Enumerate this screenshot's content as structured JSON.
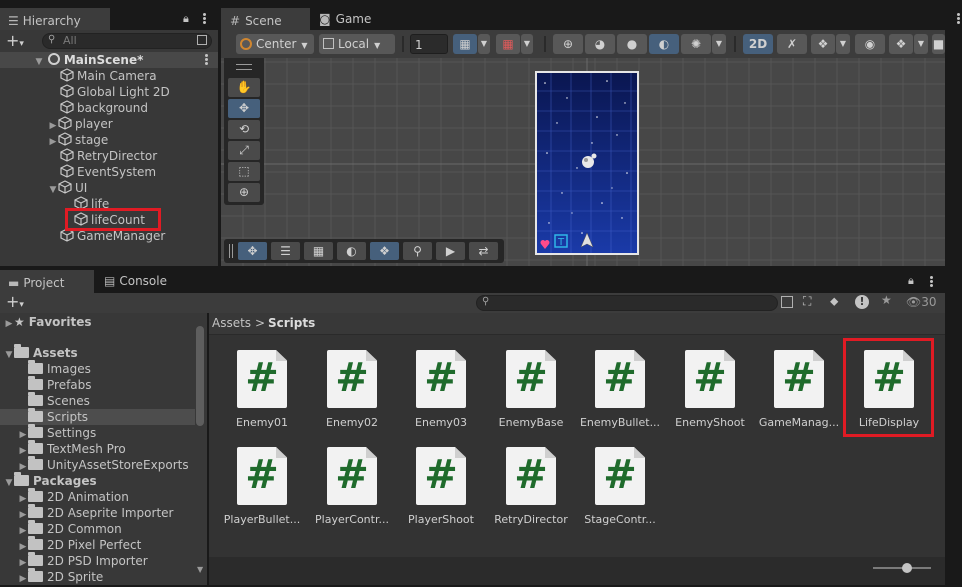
{
  "colors": {
    "accent_blue": "#46607c",
    "highlight_red": "#e01b24",
    "script_green": "#1f6b2c",
    "game_bg": "#0e1d6e",
    "selected_row": "#4d4d4d"
  },
  "hierarchy": {
    "tab_label": "Hierarchy",
    "search_placeholder": "All",
    "scene_name": "MainScene*",
    "items": [
      {
        "label": "Main Camera",
        "expandable": false
      },
      {
        "label": "Global Light 2D",
        "expandable": false
      },
      {
        "label": "background",
        "expandable": false
      },
      {
        "label": "player",
        "expandable": true
      },
      {
        "label": "stage",
        "expandable": true
      },
      {
        "label": "RetryDirector",
        "expandable": false
      },
      {
        "label": "EventSystem",
        "expandable": false
      },
      {
        "label": "UI",
        "expandable": true,
        "expanded": true
      },
      {
        "label": "life",
        "expandable": false
      },
      {
        "label": "lifeCount",
        "expandable": false,
        "highlighted": true
      },
      {
        "label": "GameManager",
        "expandable": false
      }
    ]
  },
  "scene": {
    "tabs": [
      {
        "label": "Scene",
        "icon": "grid-icon"
      },
      {
        "label": "Game",
        "icon": "gamepad-icon"
      }
    ],
    "pivot_label": "Center",
    "space_label": "Local",
    "grid_value": "1",
    "mode_2d_label": "2D"
  },
  "project": {
    "tabs": [
      {
        "label": "Project",
        "icon": "folder-icon"
      },
      {
        "label": "Console",
        "icon": "console-icon"
      }
    ],
    "hidden_count": "30",
    "breadcrumb": {
      "root": "Assets",
      "separator": ">",
      "current": "Scripts"
    },
    "tree": {
      "favorites": "Favorites",
      "assets": "Assets",
      "asset_folders": [
        "Images",
        "Prefabs",
        "Scenes",
        "Scripts",
        "Settings",
        "TextMesh Pro",
        "UnityAssetStoreExports"
      ],
      "packages": "Packages",
      "package_folders": [
        "2D Animation",
        "2D Aseprite Importer",
        "2D Common",
        "2D Pixel Perfect",
        "2D PSD Importer",
        "2D Sprite"
      ]
    },
    "files": [
      "Enemy01",
      "Enemy02",
      "Enemy03",
      "EnemyBase",
      "EnemyBullet...",
      "EnemyShoot",
      "GameManag...",
      "LifeDisplay",
      "PlayerBullet...",
      "PlayerContr...",
      "PlayerShoot",
      "RetryDirector",
      "StageContr..."
    ],
    "file_icon": "#"
  }
}
